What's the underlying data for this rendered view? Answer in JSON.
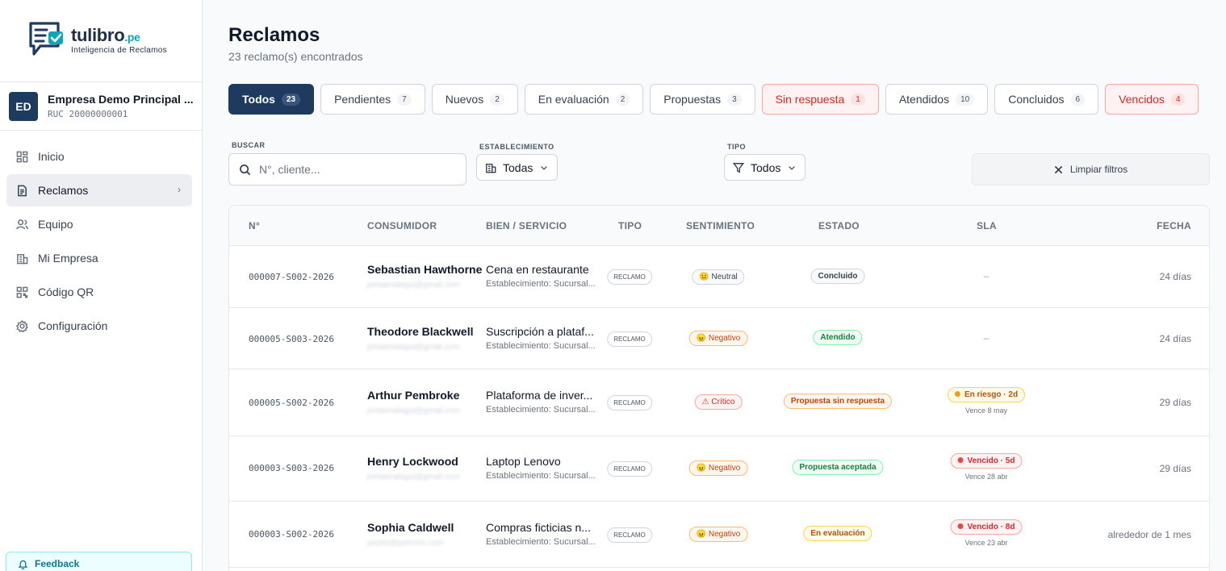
{
  "logo": {
    "name": "tulibro",
    "suffix": ".pe",
    "tagline": "Inteligencia de Reclamos"
  },
  "company": {
    "initials": "ED",
    "name": "Empresa Demo Principal ...",
    "ruc": "RUC 20000000001"
  },
  "nav": [
    {
      "label": "Inicio",
      "icon": "dashboard-icon"
    },
    {
      "label": "Reclamos",
      "icon": "document-icon",
      "active": true
    },
    {
      "label": "Equipo",
      "icon": "users-icon"
    },
    {
      "label": "Mi Empresa",
      "icon": "building-icon"
    },
    {
      "label": "Código QR",
      "icon": "qr-icon"
    },
    {
      "label": "Configuración",
      "icon": "gear-icon"
    }
  ],
  "feedback": {
    "label": "Feedback"
  },
  "page": {
    "title": "Reclamos",
    "subtitle": "23 reclamo(s) encontrados"
  },
  "tabs": [
    {
      "label": "Todos",
      "count": "23"
    },
    {
      "label": "Pendientes",
      "count": "7"
    },
    {
      "label": "Nuevos",
      "count": "2"
    },
    {
      "label": "En evaluación",
      "count": "2"
    },
    {
      "label": "Propuestas",
      "count": "3"
    },
    {
      "label": "Sin respuesta",
      "count": "1"
    },
    {
      "label": "Atendidos",
      "count": "10"
    },
    {
      "label": "Concluidos",
      "count": "6"
    },
    {
      "label": "Vencidos",
      "count": "4"
    }
  ],
  "filters": {
    "search_label": "BUSCAR",
    "search_placeholder": "N°, cliente...",
    "estab_label": "ESTABLECIMIENTO",
    "estab_value": "Todas",
    "tipo_label": "TIPO",
    "tipo_value": "Todos",
    "clear_label": "Limpiar filtros"
  },
  "table": {
    "headers": [
      "N°",
      "CONSUMIDOR",
      "BIEN / SERVICIO",
      "TIPO",
      "SENTIMIENTO",
      "ESTADO",
      "SLA",
      "FECHA"
    ],
    "rows": [
      {
        "num": "000007-S002-2026",
        "name": "Sebastian Hawthorne",
        "email": "joniaenalagui@gmail.com",
        "bien": "Cena en restaurante",
        "estab": "Establecimiento: Sucursal...",
        "tipo": "RECLAMO",
        "sent": "😐 Neutral",
        "estado": "Concluido",
        "sla": "–",
        "sla_sub": "",
        "fecha": "24 días"
      },
      {
        "num": "000005-S003-2026",
        "name": "Theodore Blackwell",
        "email": "joniaenalagui@gmail.com",
        "bien": "Suscripción a plataf...",
        "estab": "Establecimiento: Sucursal...",
        "tipo": "RECLAMO",
        "sent": "😠 Negativo",
        "estado": "Atendido",
        "sla": "–",
        "sla_sub": "",
        "fecha": "24 días"
      },
      {
        "num": "000005-S002-2026",
        "name": "Arthur Pembroke",
        "email": "joniaenalagui@gmail.com",
        "bien": "Plataforma de inver...",
        "estab": "Establecimiento: Sucursal...",
        "tipo": "RECLAMO",
        "sent": "⚠ Crítico",
        "estado": "Propuesta sin respuesta",
        "sla": "En riesgo · 2d",
        "sla_sub": "Vence 8 may",
        "fecha": "29 días"
      },
      {
        "num": "000003-S003-2026",
        "name": "Henry Lockwood",
        "email": "joniaenalagui@gmail.com",
        "bien": "Laptop Lenovo",
        "estab": "Establecimiento: Sucursal...",
        "tipo": "RECLAMO",
        "sent": "😠 Negativo",
        "estado": "Propuesta aceptada",
        "sla": "Vencido · 5d",
        "sla_sub": "Vence 28 abr",
        "fecha": "29 días"
      },
      {
        "num": "000003-S002-2026",
        "name": "Sophia Caldwell",
        "email": "pepito@pelmmo.com",
        "bien": "Compras ficticias n...",
        "estab": "Establecimiento: Sucursal...",
        "tipo": "RECLAMO",
        "sent": "😠 Negativo",
        "estado": "En evaluación",
        "sla": "Vencido · 8d",
        "sla_sub": "Vence 23 abr",
        "fecha": "alrededor de 1 mes"
      }
    ]
  },
  "colors": {
    "primary": "#1e3a5f",
    "accent": "#0ea5b7",
    "danger": "#dc2626"
  }
}
